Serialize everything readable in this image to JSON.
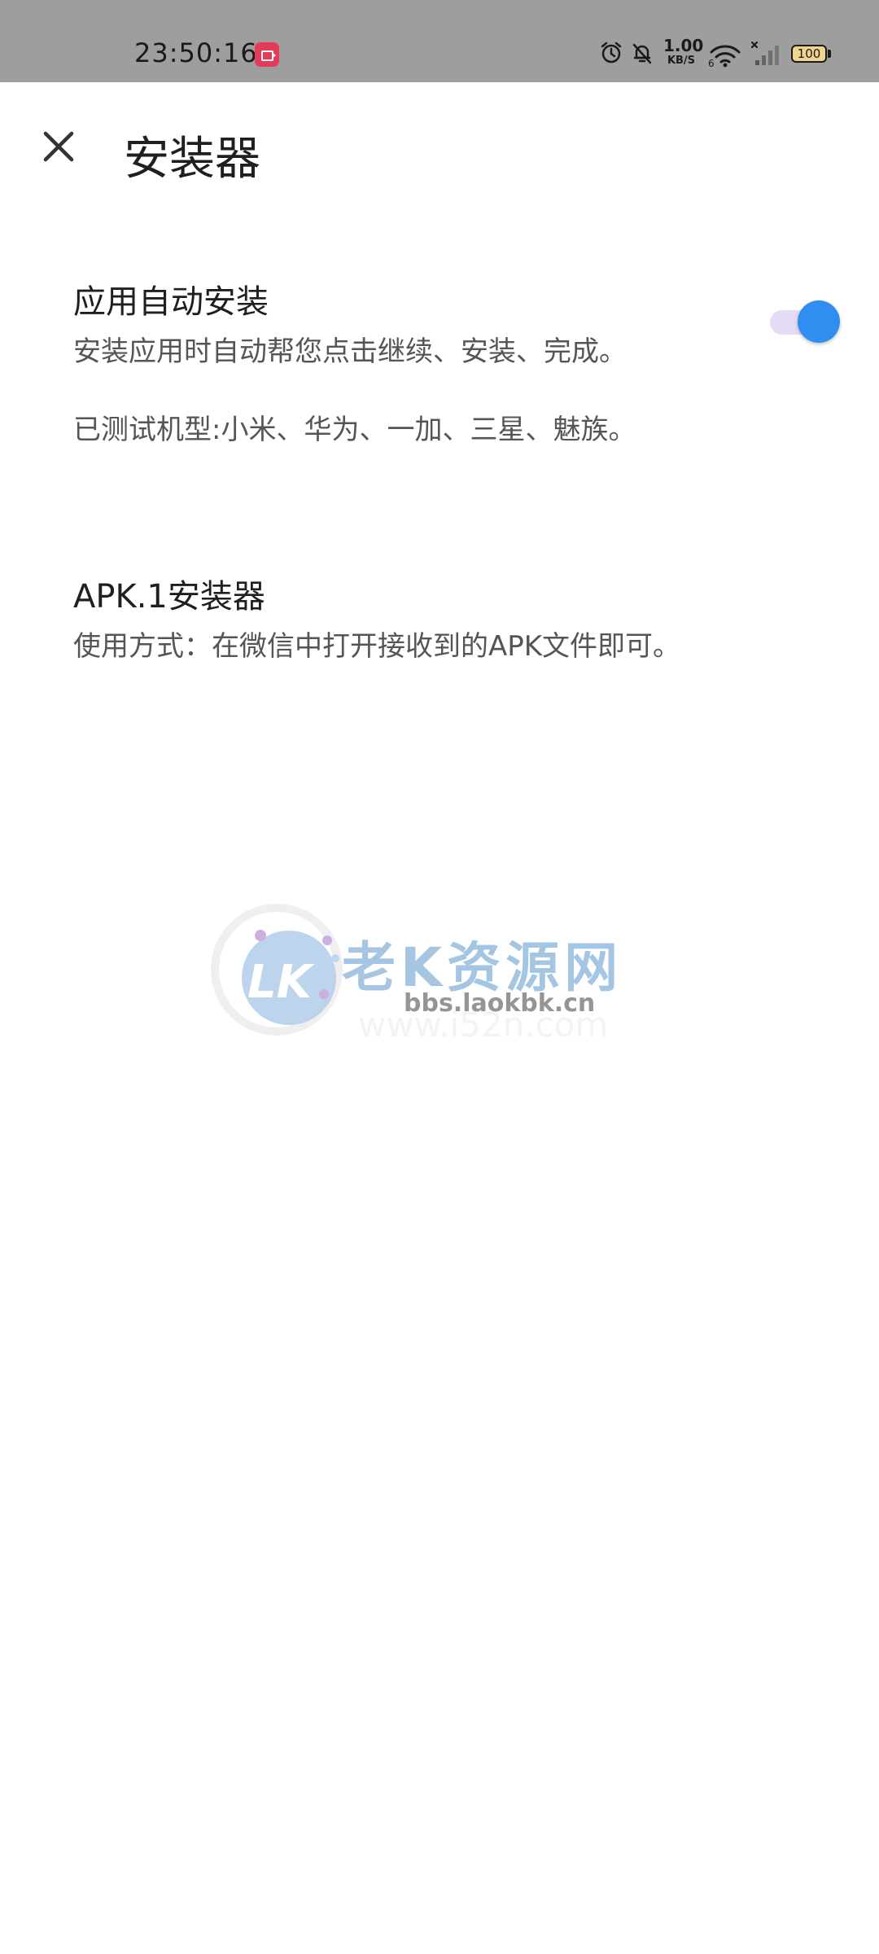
{
  "status_bar": {
    "time": "23:50:16",
    "net_speed_value": "1.00",
    "net_speed_unit": "KB/S",
    "battery": "100",
    "icons": [
      "screen-record-icon",
      "alarm-icon",
      "mute-icon",
      "wifi-icon",
      "signal-icon",
      "battery-icon"
    ]
  },
  "header": {
    "title": "安装器",
    "close_icon": "close-icon"
  },
  "settings": [
    {
      "title": "应用自动安装",
      "description": "安装应用时自动帮您点击继续、安装、完成。",
      "note": "已测试机型:小米、华为、一加、三星、魅族。",
      "toggle_on": true
    },
    {
      "title": "APK.1安装器",
      "description": "使用方式：在微信中打开接收到的APK文件即可。"
    }
  ],
  "watermark": {
    "logo": "LK",
    "text": "老K资源网",
    "url": "bbs.laokbk.cn"
  },
  "colors": {
    "status_bar_bg": "#9e9e9e",
    "toggle_thumb": "#2f8ef0",
    "toggle_track": "#e6dbf5",
    "recorder_badge": "#e33b5a"
  }
}
